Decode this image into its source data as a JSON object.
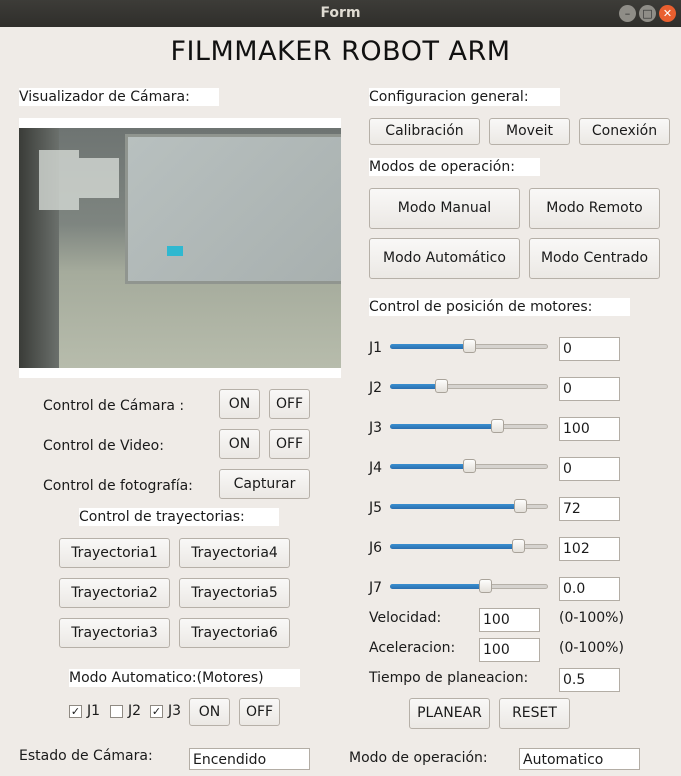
{
  "window": {
    "title": "Form"
  },
  "app_title": "FILMMAKER ROBOT ARM",
  "camera": {
    "label": "Visualizador de Cámara:",
    "control_camera_label": "Control de Cámara :",
    "control_video_label": "Control de Video:",
    "control_photo_label": "Control de fotografía:",
    "on_label": "ON",
    "off_label": "OFF",
    "capture_label": "Capturar"
  },
  "trajectories": {
    "label": "Control de trayectorias:",
    "buttons": [
      "Trayectoria1",
      "Trayectoria4",
      "Trayectoria2",
      "Trayectoria5",
      "Trayectoria3",
      "Trayectoria6"
    ]
  },
  "auto_mode": {
    "label": "Modo Automatico:(Motores)",
    "checks": [
      {
        "label": "J1",
        "checked": true
      },
      {
        "label": "J2",
        "checked": false
      },
      {
        "label": "J3",
        "checked": true
      }
    ],
    "on_label": "ON",
    "off_label": "OFF"
  },
  "general": {
    "label": "Configuracion general:",
    "buttons": [
      "Calibración",
      "Moveit",
      "Conexión"
    ]
  },
  "modes": {
    "label": "Modos de operación:",
    "buttons": [
      "Modo Manual",
      "Modo Remoto",
      "Modo Automático",
      "Modo Centrado"
    ]
  },
  "motors": {
    "label": "Control de posición de motores:",
    "joints": [
      {
        "name": "J1",
        "value": "0",
        "level": 0.5
      },
      {
        "name": "J2",
        "value": "0",
        "level": 0.32
      },
      {
        "name": "J3",
        "value": "100",
        "level": 0.68
      },
      {
        "name": "J4",
        "value": "0",
        "level": 0.5
      },
      {
        "name": "J5",
        "value": "72",
        "level": 0.82
      },
      {
        "name": "J6",
        "value": "102",
        "level": 0.81
      },
      {
        "name": "J7",
        "value": "0.0",
        "level": 0.6
      }
    ],
    "velocity_label": "Velocidad:",
    "velocity_value": "100",
    "velocity_range": "(0-100%)",
    "accel_label": "Aceleracion:",
    "accel_value": "100",
    "accel_range": "(0-100%)",
    "planning_time_label": "Tiempo de planeacion:",
    "planning_time_value": "0.5",
    "plan_button": "PLANEAR",
    "reset_button": "RESET"
  },
  "status": {
    "camera_state_label": "Estado de  Cámara:",
    "camera_state_value": "Encendido",
    "operation_mode_label": "Modo de operación:",
    "operation_mode_value": "Automatico"
  },
  "colors": {
    "accent": "#3a8fd0",
    "close_button": "#e95f2f"
  }
}
